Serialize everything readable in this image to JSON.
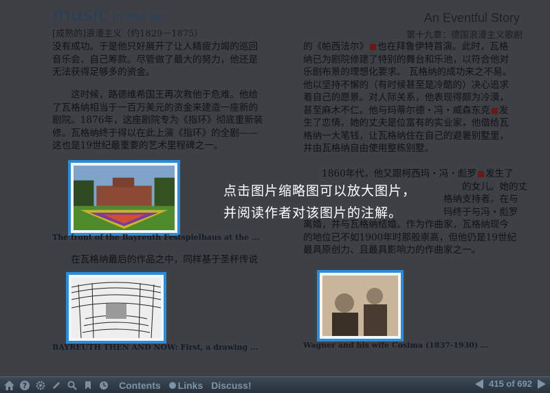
{
  "header": {
    "brand_big": "music",
    "brand_small": "in the air",
    "story_title": "An Eventful Story",
    "left_subtitle": "[成熟的]浪漫主义（约1829－1875）",
    "right_subtitle": "第十九章：德国浪漫主义歌剧"
  },
  "left_column": {
    "para1": "没有成功。于是他只好展开了让人精疲力竭的巡回\n音乐会、自己筹款。尽管做了最大的努力，他还是\n无法获得足够多的资金。",
    "para2": "　　这时候，路德维希国王再次救他于危难。他给\n了瓦格纳相当于一百万美元的资金来建造一座新的\n剧院。1876年，这座剧院专为《指环》彻底重新装\n修。瓦格纳终于得以在此上演《指环》的全剧——\n这也是19世纪最重要的艺术里程碑之一。",
    "para3": "　　在瓦格纳最后的作品之中，同样基于圣杯传说"
  },
  "right_column": {
    "para1_a": "的《帕西法尔》",
    "para1_b": "也在拜鲁伊特首演。此时，瓦格\n纳已为剧院修建了特别的舞台和乐池，以符合他对\n乐剧布景的理想化要求。 瓦格纳的成功来之不易。\n他以坚持不懈的（有时候甚至是冷酷的）决心追求\n着自己的愿景。对人际关系，他表现得颇为冷漠，\n甚至麻木不仁。他与玛蒂尔德・冯・威森东克",
    "para1_c": "发\n生了恋情。她的丈夫是位富有的实业家，他借给瓦\n格纳一大笔钱，让瓦格纳住在自己的避暑别墅里，\n并由瓦格纳自由使用整栋别墅。",
    "para2_a": "　　1860年代，他又跟柯西玛・冯・彪罗",
    "para2_b": "发生了\n　　　　　　　　　　　　　　　　　的女儿。她的丈\n　　　　　　　　　　　　　　　格纳支持者。在与\n　　　　　　　　　　　　　　　玛终于与冯・彪罗\n离婚，并与瓦格纳结婚。作为作曲家，瓦格纳现今\n的地位已不如1900年时那般崇高，但他仍是19世纪\n最具原创力、且最具影响力的作曲家之一。"
  },
  "thumbnails": [
    {
      "caption": "The front of the Bayreuth Festspielhaus at the ..."
    },
    {
      "caption": "BAYREUTH THEN AND NOW: First, a drawing ..."
    },
    {
      "caption": "Wagner and his wife Cosima (1837-1930) ..."
    }
  ],
  "overlay": {
    "text": "点击图片缩略图可以放大图片，\n并阅读作者对该图片的注解。"
  },
  "toolbar": {
    "contents": "Contents",
    "links": "Links",
    "discuss": "Discuss!",
    "page_indicator": "415 of 692",
    "icons": [
      "home-icon",
      "help-icon",
      "gear-icon",
      "pencil-icon",
      "search-icon",
      "bookmark-icon",
      "clock-icon"
    ]
  },
  "colors": {
    "thumb_border": "#2e8bd6",
    "toolbar_text": "#7f93a8",
    "brand": "#2a3e5c"
  }
}
